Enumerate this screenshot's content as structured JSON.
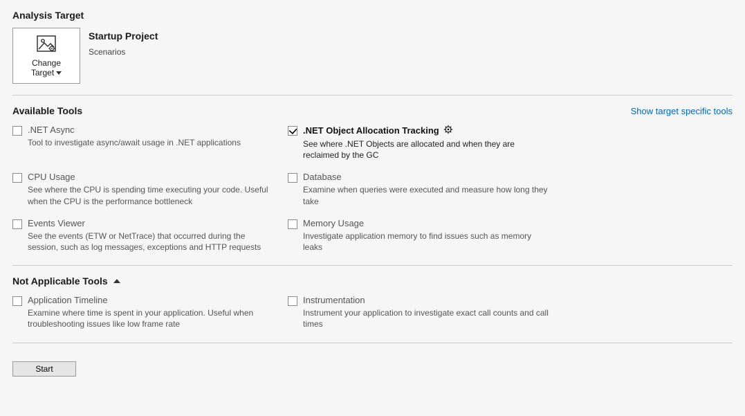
{
  "analysis_target": {
    "heading": "Analysis Target",
    "change_target": {
      "line1": "Change",
      "line2": "Target"
    },
    "project_title": "Startup Project",
    "project_sub": "Scenarios"
  },
  "available": {
    "heading": "Available Tools",
    "link": "Show target specific tools",
    "tools": [
      {
        "checked": false,
        "title": ".NET Async",
        "desc": "Tool to investigate async/await usage in .NET applications",
        "gear": false
      },
      {
        "checked": true,
        "title": ".NET Object Allocation Tracking",
        "desc": "See where .NET Objects are allocated and when they are reclaimed by the GC",
        "gear": true
      },
      {
        "checked": false,
        "title": "CPU Usage",
        "desc": "See where the CPU is spending time executing your code. Useful when the CPU is the performance bottleneck",
        "gear": false
      },
      {
        "checked": false,
        "title": "Database",
        "desc": "Examine when queries were executed and measure how long they take",
        "gear": false
      },
      {
        "checked": false,
        "title": "Events Viewer",
        "desc": "See the events (ETW or NetTrace) that occurred during the session, such as log messages, exceptions and HTTP requests",
        "gear": false
      },
      {
        "checked": false,
        "title": "Memory Usage",
        "desc": "Investigate application memory to find issues such as memory leaks",
        "gear": false
      }
    ]
  },
  "not_applicable": {
    "heading": "Not Applicable Tools",
    "tools": [
      {
        "checked": false,
        "title": "Application Timeline",
        "desc": "Examine where time is spent in your application. Useful when troubleshooting issues like low frame rate"
      },
      {
        "checked": false,
        "title": "Instrumentation",
        "desc": "Instrument your application to investigate exact call counts and call times"
      }
    ]
  },
  "start": "Start"
}
